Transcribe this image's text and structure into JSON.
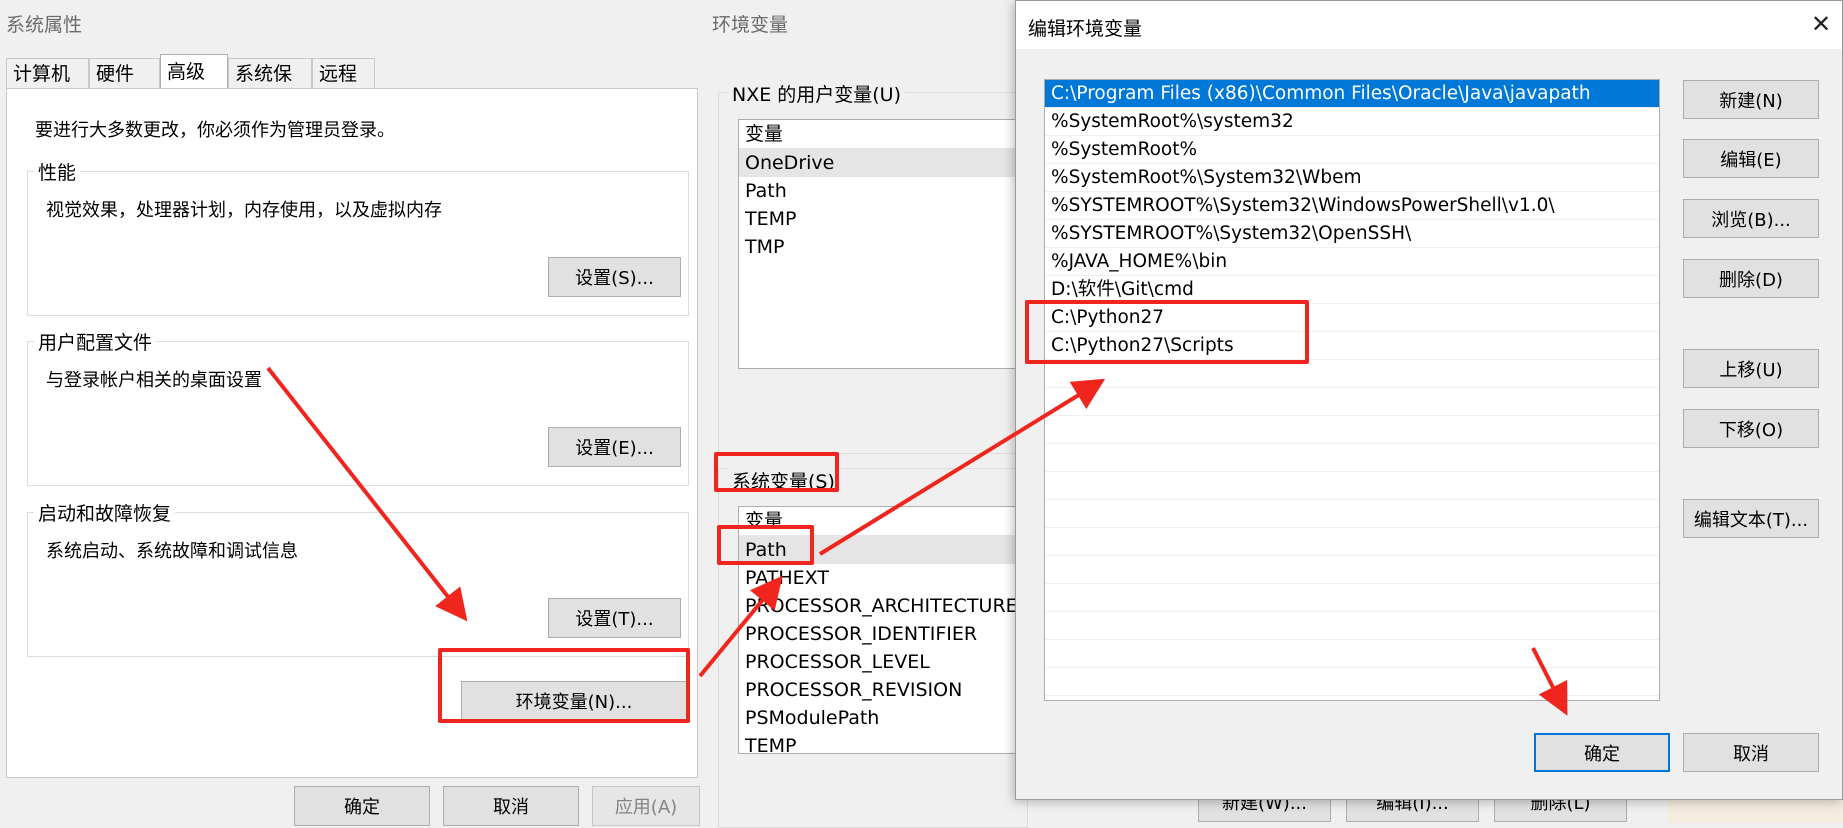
{
  "system_properties": {
    "title": "系统属性",
    "tabs": [
      {
        "label": "计算机名",
        "active": false
      },
      {
        "label": "硬件",
        "active": false
      },
      {
        "label": "高级",
        "active": true
      },
      {
        "label": "系统保护",
        "active": false
      },
      {
        "label": "远程",
        "active": false
      }
    ],
    "admin_note": "要进行大多数更改，你必须作为管理员登录。",
    "performance": {
      "title": "性能",
      "desc": "视觉效果，处理器计划，内存使用，以及虚拟内存",
      "button": "设置(S)..."
    },
    "user_profiles": {
      "title": "用户配置文件",
      "desc": "与登录帐户相关的桌面设置",
      "button": "设置(E)..."
    },
    "startup_recovery": {
      "title": "启动和故障恢复",
      "desc": "系统启动、系统故障和调试信息",
      "button": "设置(T)..."
    },
    "env_button": "环境变量(N)...",
    "ok": "确定",
    "cancel": "取消",
    "apply": "应用(A)"
  },
  "env_vars": {
    "title": "环境变量",
    "user_section": "NXE 的用户变量(U)",
    "user_header": "变量",
    "user_vars": [
      "OneDrive",
      "Path",
      "TEMP",
      "TMP"
    ],
    "system_section": "系统变量(S)",
    "system_header": "变量",
    "system_vars": [
      "Path",
      "PATHEXT",
      "PROCESSOR_ARCHITECTURE",
      "PROCESSOR_IDENTIFIER",
      "PROCESSOR_LEVEL",
      "PROCESSOR_REVISION",
      "PSModulePath",
      "TEMP"
    ],
    "bottom_buttons": [
      "新建(W)...",
      "编辑(I)...",
      "删除(L)"
    ]
  },
  "edit_env": {
    "title": "编辑环境变量",
    "close_glyph": "✕",
    "paths": [
      "C:\\Program Files (x86)\\Common Files\\Oracle\\Java\\javapath",
      "%SystemRoot%\\system32",
      "%SystemRoot%",
      "%SystemRoot%\\System32\\Wbem",
      "%SYSTEMROOT%\\System32\\WindowsPowerShell\\v1.0\\",
      "%SYSTEMROOT%\\System32\\OpenSSH\\",
      "%JAVA_HOME%\\bin",
      "D:\\软件\\Git\\cmd",
      "C:\\Python27",
      "C:\\Python27\\Scripts"
    ],
    "buttons": {
      "new": "新建(N)",
      "edit": "编辑(E)",
      "browse": "浏览(B)...",
      "delete": "删除(D)",
      "move_up": "上移(U)",
      "move_down": "下移(O)",
      "edit_text": "编辑文本(T)..."
    },
    "ok": "确定",
    "cancel": "取消"
  },
  "colors": {
    "annotation": "#f0251d",
    "selection": "#0078d7"
  }
}
